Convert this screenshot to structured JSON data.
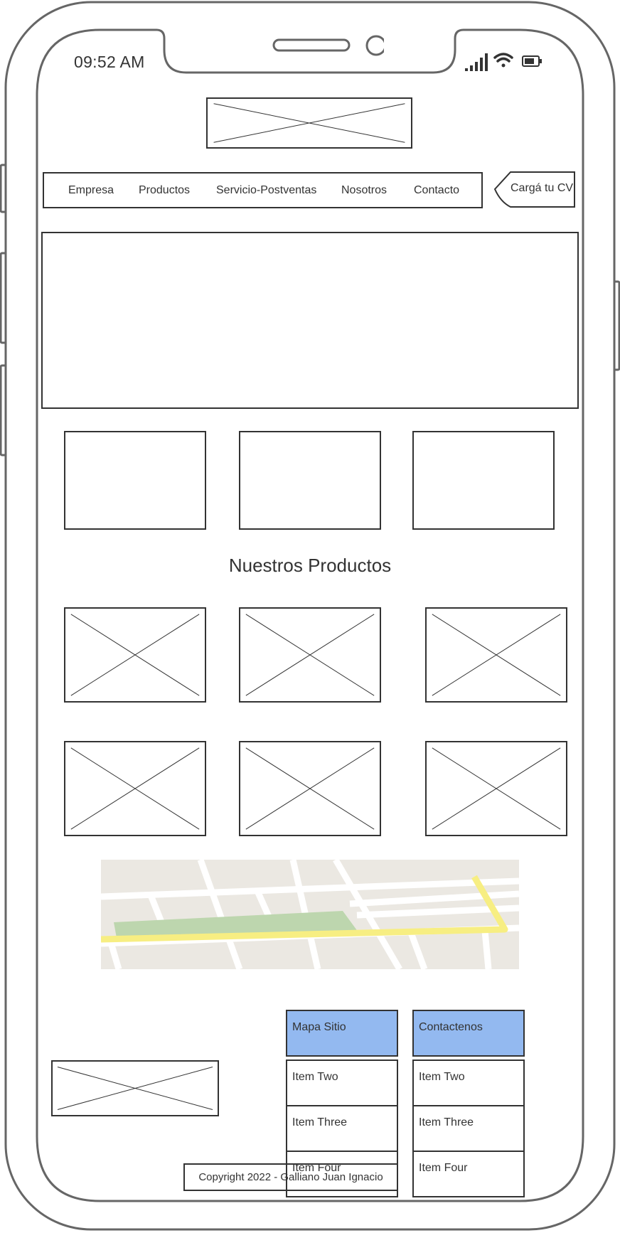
{
  "status_bar": {
    "time": "09:52 AM",
    "icons": [
      "signal-icon",
      "wifi-icon",
      "battery-icon"
    ]
  },
  "nav": {
    "items": [
      {
        "label": "Empresa"
      },
      {
        "label": "Productos"
      },
      {
        "label": "Servicio-Postventas"
      },
      {
        "label": "Nosotros"
      },
      {
        "label": "Contacto"
      }
    ],
    "cv_button_label": "Cargá tu CV"
  },
  "products": {
    "title": "Nuestros Productos"
  },
  "footer": {
    "sitemap": {
      "header": "Mapa Sitio",
      "items": [
        "Item Two",
        "Item Three",
        "Item Four"
      ]
    },
    "contact": {
      "header": "Contactenos",
      "items": [
        "Item Two",
        "Item Three",
        "Item Four"
      ]
    },
    "copyright": "Copyright 2022 - Galliano Juan Ignacio"
  },
  "colors": {
    "outline": "#666666",
    "stroke": "#333333",
    "list_header": "#93b9f0",
    "map_bg": "#ebe8e2",
    "map_park": "#bdd6ae",
    "map_route": "#f7ee82"
  }
}
